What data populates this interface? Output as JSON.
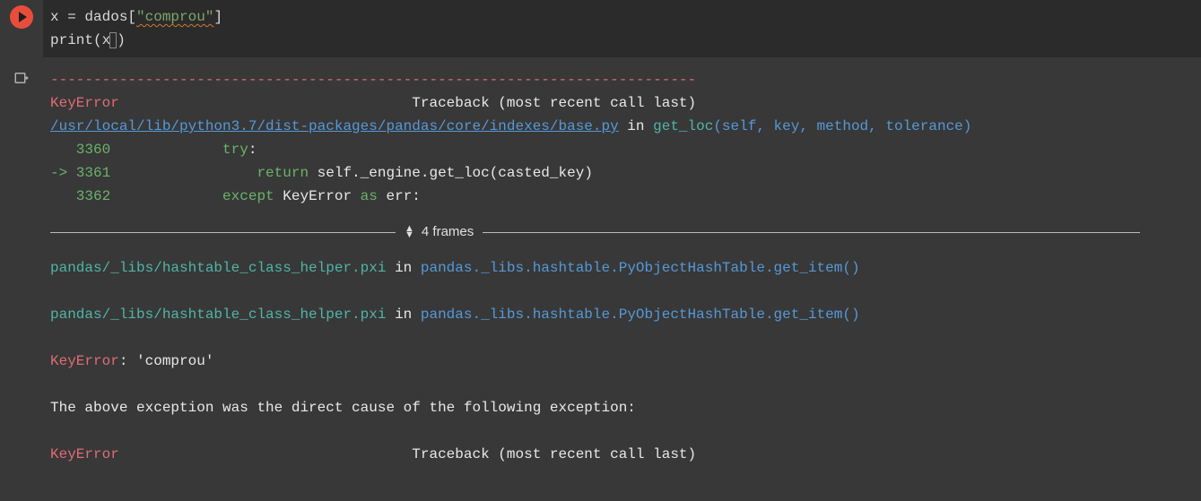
{
  "code": {
    "line1_pre": "x = dados[",
    "line1_str": "\"comprou\"",
    "line1_post": "]",
    "line2_fn": "print",
    "line2_open": "(",
    "line2_arg": "x",
    "line2_close": ")"
  },
  "output": {
    "dashes": "---------------------------------------------------------------------------",
    "err1": "KeyError",
    "tb1_spaces": "                                  ",
    "tb1": "Traceback (most recent call last)",
    "link1": "/usr/local/lib/python3.7/dist-packages/pandas/core/indexes/base.py",
    "in": " in ",
    "fn_getloc": "get_loc",
    "sig_getloc": "(self, key, method, tolerance)",
    "ln3360": "   3360",
    "ln3360_code_indent": "             ",
    "ln3360_try": "try",
    "ln3360_colon": ":",
    "ln3361_arrow": "-> 3361",
    "ln3361_indent": "                 ",
    "ln3361_return": "return",
    "ln3361_rest": " self._engine.get_loc(casted_key)",
    "ln3362": "   3362",
    "ln3362_indent": "             ",
    "ln3362_except": "except",
    "ln3362_sp": " ",
    "ln3362_keyerr": "KeyError",
    "ln3362_as": " as",
    "ln3362_err": " err:",
    "frames_label": "4 frames",
    "helper1_path": "pandas/_libs/hashtable_class_helper.pxi",
    "helper_in": " in ",
    "helper1_call": "pandas._libs.hashtable.PyObjectHashTable.get_item()",
    "helper2_path": "pandas/_libs/hashtable_class_helper.pxi",
    "helper2_call": "pandas._libs.hashtable.PyObjectHashTable.get_item()",
    "keyerr2": "KeyError",
    "keyerr2_msg": ": 'comprou'",
    "cause_text": "The above exception was the direct cause of the following exception:",
    "err3": "KeyError",
    "tb3_spaces": "                                  ",
    "tb3": "Traceback (most recent call last)"
  }
}
